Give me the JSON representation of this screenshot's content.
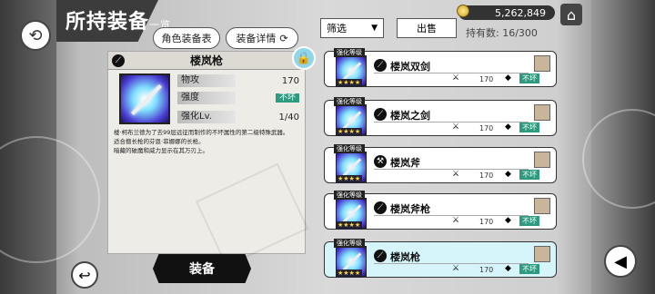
{
  "header": {
    "title": "所持装备",
    "title_suffix": "一览",
    "tab_equip_chara": "角色装备表",
    "tab_equip_detail": "装备详情"
  },
  "detail": {
    "name": "楼岚枪",
    "stats": [
      {
        "label": "物攻",
        "value": "170"
      },
      {
        "label": "强度",
        "value": "不坏"
      },
      {
        "label": "强化Lv.",
        "value": "1/40"
      }
    ],
    "description": [
      "楼·柯布兰德为了去99层远征而制作的不坏属性的第二级特殊武器。",
      "适合擅长枪的芬恩·菲娜娜的长枪。",
      "暗藏的破魔和威力显示在其万刃上。"
    ],
    "equip_label": "装备"
  },
  "topbar": {
    "gold": "5,262,849",
    "filter_label": "筛选",
    "sell_label": "出售",
    "count_text": "持有数: 16/300"
  },
  "items": [
    {
      "enh": "强化等级",
      "name": "楼岚双剑",
      "atk": "170",
      "badge": "不坏",
      "stars": "★★★★",
      "selected": false
    },
    {
      "enh": "强化等级",
      "name": "楼岚之剑",
      "atk": "170",
      "badge": "不坏",
      "stars": "★★★★",
      "selected": false
    },
    {
      "enh": "强化等级",
      "name": "楼岚斧",
      "atk": "170",
      "badge": "不坏",
      "stars": "★★★★",
      "selected": false
    },
    {
      "enh": "强化等级",
      "name": "楼岚斧枪",
      "atk": "170",
      "badge": "不坏",
      "stars": "★★★★",
      "selected": false
    },
    {
      "enh": "强化等级",
      "name": "楼岚枪",
      "atk": "170",
      "badge": "不坏",
      "stars": "★★★★",
      "selected": true
    }
  ],
  "icons": {
    "sync": "sync-icon",
    "refresh": "refresh-icon",
    "home": "home-icon",
    "lock": "lock-icon",
    "sound": "speaker-icon",
    "back": "back-icon"
  }
}
